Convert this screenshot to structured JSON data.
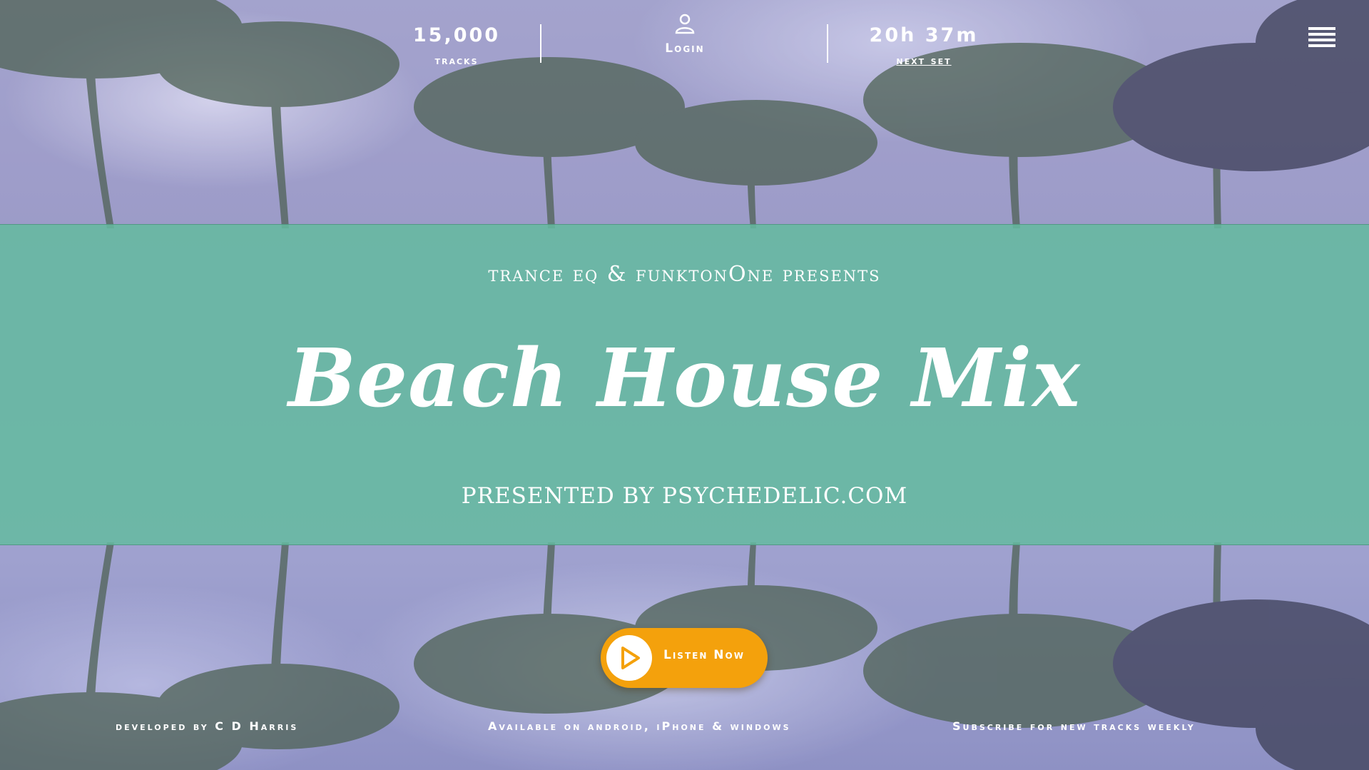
{
  "header": {
    "tracks_count": "15,000",
    "tracks_label": "tracks",
    "login_label": "Login",
    "login_icon": "user-icon",
    "countdown": "20h 37m",
    "countdown_label": "next set",
    "menu_icon": "hamburger-menu-icon"
  },
  "banner": {
    "presents": "trance eq & funktonOne presents",
    "title": "Beach House Mix",
    "byline": "PRESENTED BY PSYCHEDELIC.COM",
    "color": "#64baa0"
  },
  "cta": {
    "label": "Listen Now",
    "icon": "play-icon",
    "color": "#f4a10c"
  },
  "footer": {
    "developer": "developed by C D Harris",
    "availability": "Available on android, iPhone & windows",
    "subscribe": "Subscribe for new tracks weekly"
  }
}
